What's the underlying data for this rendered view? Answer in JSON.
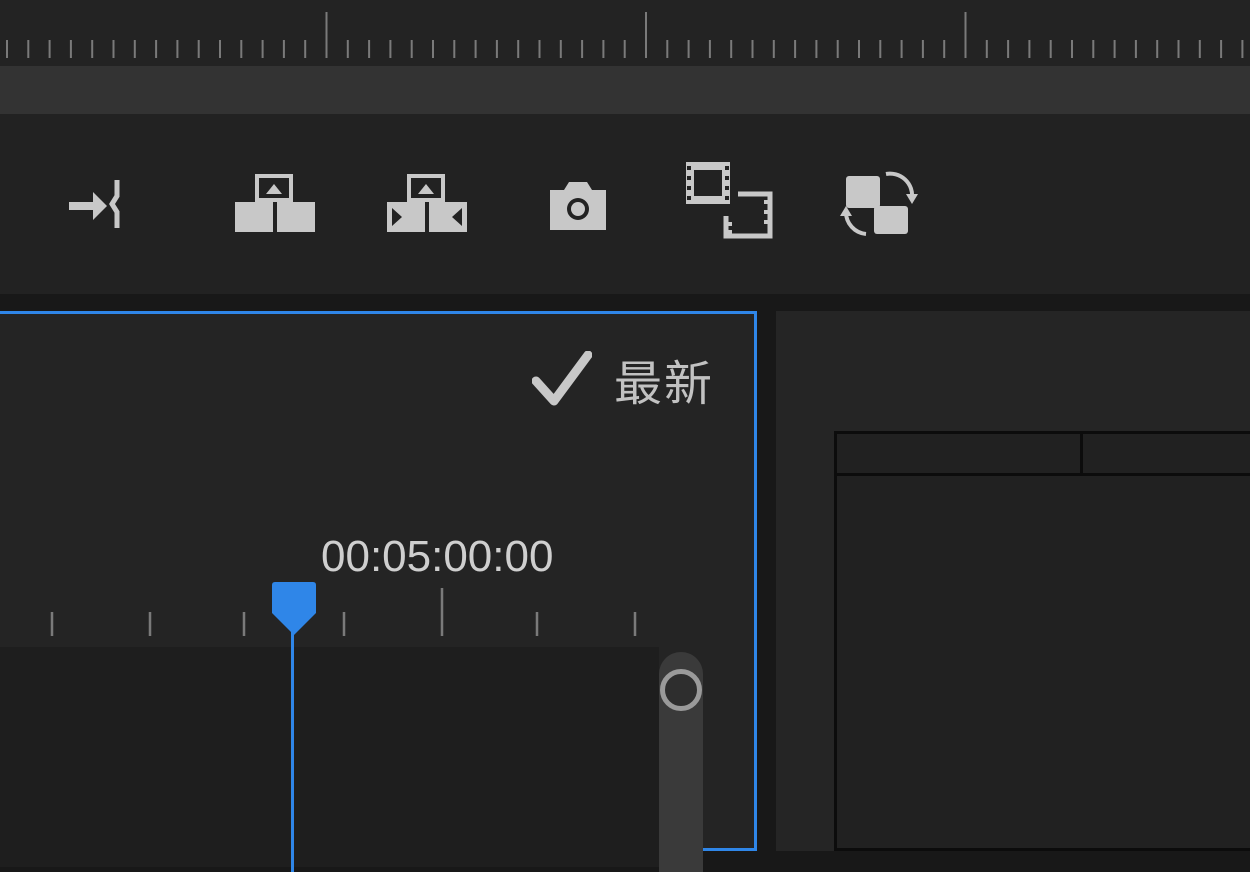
{
  "toolbar": {
    "tools": [
      {
        "name": "insert-edit-icon"
      },
      {
        "name": "lift-icon"
      },
      {
        "name": "extract-icon"
      },
      {
        "name": "export-frame-camera-icon"
      },
      {
        "name": "comparison-view-icon"
      },
      {
        "name": "swap-views-icon"
      }
    ]
  },
  "source_panel": {
    "status_label": "最新",
    "status_icon": "checkmark-icon",
    "timecode": "00:05:00:00"
  },
  "colors": {
    "accent": "#2f86e8",
    "background": "#181818",
    "panel": "#242424",
    "icon": "#c8c8c8"
  }
}
